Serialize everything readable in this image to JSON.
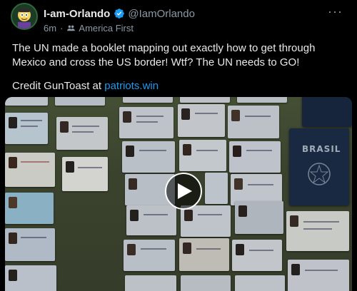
{
  "post": {
    "author": {
      "display_name": "I-am-Orlando",
      "handle": "@IamOrlando",
      "verified": true
    },
    "time": "6m",
    "separator": "·",
    "community": "America First",
    "text": "The UN made a booklet mapping out exactly how to get through Mexico and cross the US border! Wtf? The UN needs to GO!",
    "credit_prefix": "Credit GunToast at ",
    "credit_link": "patriots.win",
    "more_label": "···",
    "media": {
      "type": "video",
      "passport_text": "BRASIL"
    }
  },
  "colors": {
    "background": "#000000",
    "text": "#e7e9ea",
    "muted": "#8b98a5",
    "link": "#1d9bf0",
    "verified": "#1d9bf0"
  }
}
